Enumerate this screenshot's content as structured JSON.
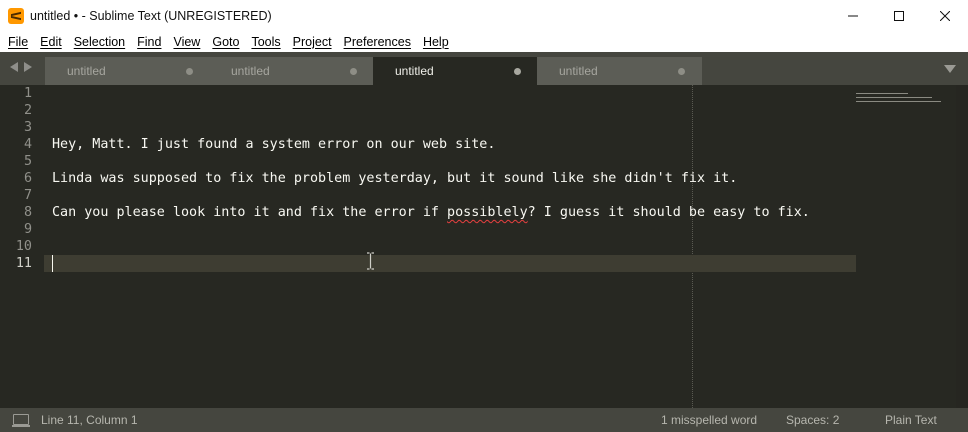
{
  "window": {
    "title": "untitled • - Sublime Text (UNREGISTERED)"
  },
  "menu": [
    "File",
    "Edit",
    "Selection",
    "Find",
    "View",
    "Goto",
    "Tools",
    "Project",
    "Preferences",
    "Help"
  ],
  "tabs": [
    {
      "label": "untitled",
      "active": false
    },
    {
      "label": "untitled",
      "active": false
    },
    {
      "label": "untitled",
      "active": true
    },
    {
      "label": "untitled",
      "active": false
    }
  ],
  "editor": {
    "current_line": 11,
    "lines": [
      {
        "number": "1",
        "text": ""
      },
      {
        "number": "2",
        "text": ""
      },
      {
        "number": "3",
        "text": ""
      },
      {
        "number": "4",
        "text": "Hey, Matt. I just found a system error on our web site."
      },
      {
        "number": "5",
        "text": ""
      },
      {
        "number": "6",
        "text": "Linda was supposed to fix the problem yesterday, but it sound like she didn't fix it."
      },
      {
        "number": "7",
        "text": ""
      },
      {
        "number": "8",
        "text_before": "Can you please look into it and fix the error if ",
        "misspelled": "possiblely",
        "text_after": "? I guess it should be easy to fix."
      },
      {
        "number": "9",
        "text": ""
      },
      {
        "number": "10",
        "text": ""
      },
      {
        "number": "11",
        "text": ""
      }
    ]
  },
  "status": {
    "position": "Line 11, Column 1",
    "spelling": "1 misspelled word",
    "indentation": "Spaces: 2",
    "syntax": "Plain Text"
  },
  "colors": {
    "editor_bg": "#272822",
    "chrome": "#45463f",
    "text": "#f8f8f2",
    "line_highlight": "#3e3d32"
  }
}
